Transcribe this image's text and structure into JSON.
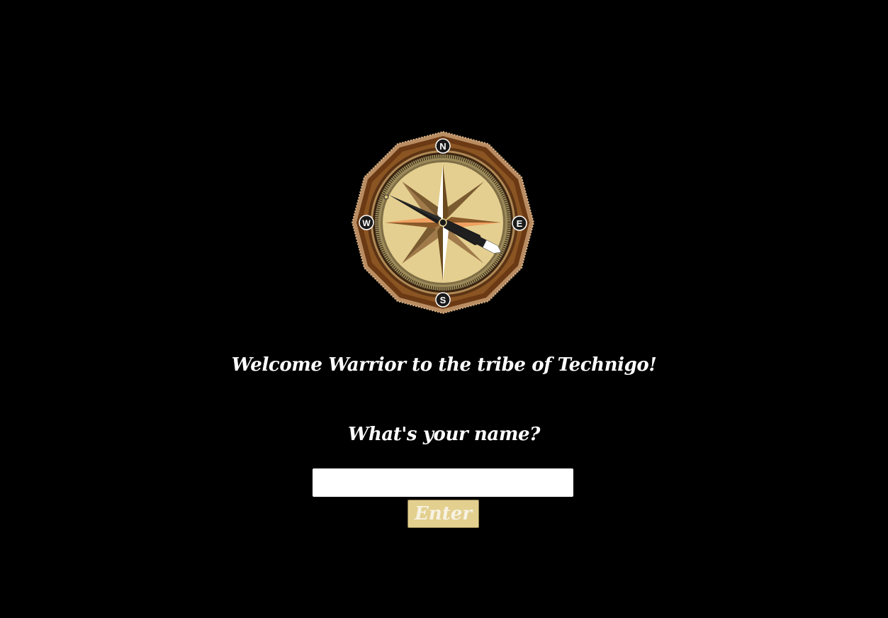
{
  "welcome": {
    "heading": "Welcome Warrior to the tribe of Technigo!"
  },
  "form": {
    "question": "What's your name?",
    "name_value": "",
    "name_placeholder": "",
    "enter_label": "Enter"
  },
  "compass": {
    "icon": "compass-icon",
    "north": "N",
    "east": "E",
    "south": "S",
    "west": "W"
  },
  "colors": {
    "background": "#000000",
    "button_bg": "#e3d08f",
    "compass_face": "#e4cf90",
    "compass_rim": "#7a4a1e",
    "text": "#ffffff"
  }
}
